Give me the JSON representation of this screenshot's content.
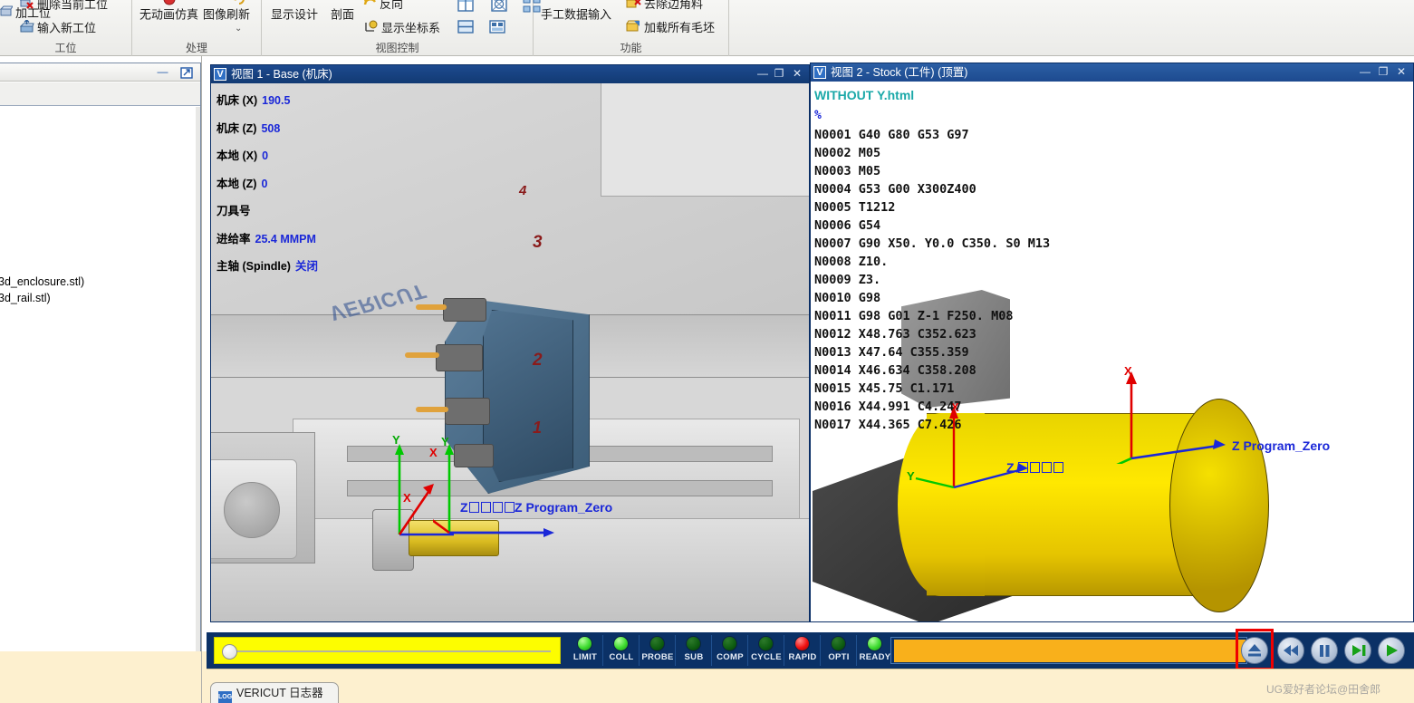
{
  "ribbon": {
    "groups": [
      {
        "label": "工位",
        "items": [
          {
            "label": "加工位",
            "icon": "workpiece-icon"
          },
          {
            "label": "删除当前工位",
            "icon": "delete-station-icon"
          },
          {
            "label": "输入新工位",
            "icon": "import-station-icon"
          }
        ]
      },
      {
        "label": "处理",
        "items": [
          {
            "label": "无动画仿真",
            "icon": "no-animation-icon"
          },
          {
            "label": "图像刷新",
            "icon": "refresh-image-icon"
          }
        ]
      },
      {
        "label": "视图控制",
        "items": [
          {
            "label": "显示设计",
            "icon": "show-design-icon"
          },
          {
            "label": "剖面",
            "icon": "section-icon"
          },
          {
            "label": "反向",
            "icon": "reverse-icon"
          },
          {
            "label": "显示坐标系",
            "icon": "show-csys-icon"
          }
        ]
      },
      {
        "label": "功能",
        "items": [
          {
            "label": "手工数据输入",
            "icon": "mdi-icon"
          },
          {
            "label": "去除边角料",
            "icon": "remove-scrap-icon"
          },
          {
            "label": "加载所有毛坯",
            "icon": "load-all-stock-icon"
          }
        ]
      }
    ]
  },
  "left_panel": {
    "minimize_label": "—",
    "restore_label": "⇱",
    "tree_nodes": [
      "3d_enclosure.stl)",
      "3d_rail.stl)"
    ]
  },
  "view1": {
    "title": "视图 1 - Base (机床)",
    "logo": "V",
    "controls": {
      "minimize": "—",
      "maximize": "❐",
      "close": "✕"
    },
    "status": [
      {
        "label": "机床 (X)",
        "value": "190.5"
      },
      {
        "label": "机床 (Z)",
        "value": "508"
      },
      {
        "label": "本地 (X)",
        "value": "0"
      },
      {
        "label": "本地 (Z)",
        "value": "0"
      },
      {
        "label": "刀具号",
        "value": ""
      },
      {
        "label": "进给率",
        "value": "25.4 MMPM"
      },
      {
        "label": "主轴 (Spindle)",
        "value": "关闭"
      }
    ],
    "watermark_text": "VERICUT",
    "axis_labels": {
      "x": "X",
      "y": "Y",
      "z": "Z"
    },
    "turret_numbers": [
      "4",
      "3",
      "2",
      "1"
    ],
    "program_zero_label": "Z Program_Zero",
    "program_zero_cjk_prefix": "Z"
  },
  "view2": {
    "title": "视图 2 - Stock (工件) (顶置)",
    "logo": "V",
    "controls": {
      "minimize": "—",
      "maximize": "❐",
      "close": "✕"
    },
    "gcode": {
      "filename": "WITHOUT Y.html",
      "percent": "%",
      "lines": [
        "N0001 G40 G80 G53 G97",
        "N0002 M05",
        "N0003 M05",
        "N0004 G53 G00 X300Z400",
        "N0005 T1212",
        "N0006 G54",
        "N0007 G90 X50. Y0.0 C350. S0 M13",
        "N0008 Z10.",
        "N0009 Z3.",
        "N0010 G98",
        "N0011 G98 G01 Z-1 F250. M08",
        "N0012 X48.763 C352.623",
        "N0013 X47.64 C355.359",
        "N0014 X46.634 C358.208",
        "N0015 X45.75 C1.171",
        "N0016 X44.991 C4.247",
        "N0017 X44.365 C7.426"
      ]
    },
    "axis_labels": {
      "x": "X",
      "y": "Y",
      "z": "Z"
    },
    "program_zero_label": "Z Program_Zero",
    "program_zero_cjk_prefix": "Z"
  },
  "bottom_bar": {
    "speed_slider": {
      "name": "speed-slider",
      "value_pct": 2
    },
    "leds": [
      {
        "label": "LIMIT",
        "state": "on",
        "color": "#3ddb2f"
      },
      {
        "label": "COLL",
        "state": "on",
        "color": "#3ddb2f"
      },
      {
        "label": "PROBE",
        "state": "off",
        "color": "#0d5c10"
      },
      {
        "label": "SUB",
        "state": "off",
        "color": "#0d5c10"
      },
      {
        "label": "COMP",
        "state": "off",
        "color": "#0d5c10"
      },
      {
        "label": "CYCLE",
        "state": "off",
        "color": "#0d5c10"
      },
      {
        "label": "RAPID",
        "state": "alert",
        "color": "#f01010"
      },
      {
        "label": "OPTI",
        "state": "off",
        "color": "#0d5c10"
      },
      {
        "label": "READY",
        "state": "on",
        "color": "#3ddb2f"
      }
    ],
    "progress": {
      "name": "simulation-progress",
      "value_pct": 100,
      "color": "#f9b01b"
    },
    "buttons": [
      {
        "name": "eject-button",
        "icon": "eject-icon",
        "highlighted": true
      },
      {
        "name": "rewind-button",
        "icon": "rewind-icon",
        "highlighted": false
      },
      {
        "name": "pause-button",
        "icon": "pause-icon",
        "highlighted": false
      },
      {
        "name": "step-button",
        "icon": "step-forward-icon",
        "highlighted": false
      },
      {
        "name": "play-button",
        "icon": "play-icon",
        "highlighted": false
      }
    ]
  },
  "status_tab": {
    "label": "VERICUT 日志器",
    "logo": "LOG"
  },
  "watermark": "UG爱好者论坛@田舍郎",
  "colors": {
    "titlebar": "#123a73",
    "botbar": "#0b3166",
    "accent_blue": "#1a27d8",
    "stock_yellow": "#ffe800",
    "progress_orange": "#f9b01b",
    "highlight_red": "#ef0000",
    "gcode_teal": "#1aa8a8"
  }
}
